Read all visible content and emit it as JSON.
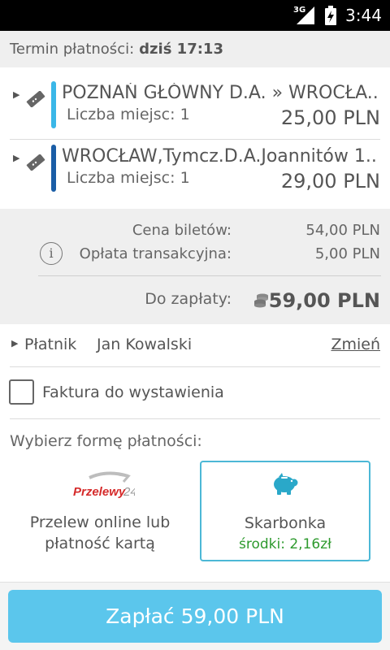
{
  "status_bar": {
    "network": "3G",
    "time": "3:44"
  },
  "deadline": {
    "label": "Termin płatności:",
    "value": "dziś 17:13"
  },
  "tickets": [
    {
      "route": "POZNAŃ GŁÓWNY D.A. » WROCŁA..",
      "seats": "Liczba miejsc: 1",
      "price": "25,00 PLN",
      "color": "#3ab7e8"
    },
    {
      "route": "WROCŁAW,Tymcz.D.A.Joannitów 1..",
      "seats": "Liczba miejsc: 1",
      "price": "29,00 PLN",
      "color": "#1a5da6"
    }
  ],
  "summary": {
    "tickets_label": "Cena biletów:",
    "tickets_value": "54,00 PLN",
    "fee_label": "Opłata transakcyjna:",
    "fee_value": "5,00 PLN",
    "total_label": "Do zapłaty:",
    "total_value": "59,00 PLN"
  },
  "payer": {
    "label": "Płatnik",
    "name": "Jan Kowalski",
    "change": "Zmień"
  },
  "invoice": {
    "label": "Faktura do wystawienia",
    "checked": false
  },
  "payment": {
    "title": "Wybierz formę płatności:",
    "przelewy": {
      "logo_text": "Przelewy24",
      "line1": "Przelew online lub",
      "line2": "płatność kartą"
    },
    "skarbonka": {
      "name": "Skarbonka",
      "funds": "środki: 2,16zł"
    }
  },
  "pay_button": "Zapłać 59,00 PLN",
  "colors": {
    "accent": "#5bc6ec",
    "selected_border": "#4cb8d6",
    "funds_green": "#2e9a2e",
    "brand_red": "#d52b2b"
  },
  "icons": [
    "signal-icon",
    "battery-icon",
    "ticket-icon",
    "info-icon",
    "coins-icon",
    "piggy-bank-icon"
  ]
}
